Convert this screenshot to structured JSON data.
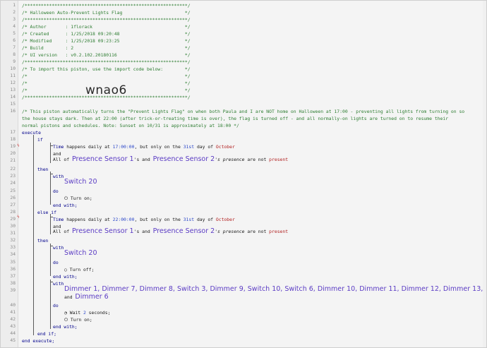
{
  "watermark": "wnao6",
  "header_lines": [
    "/************************************************************/",
    "/* Halloween Auto-Prevent Lights Flag                       */",
    "/************************************************************/",
    "/* Author       : 1florack                                  */",
    "/* Created      : 1/25/2018 09:20:48                        */",
    "/* Modified     : 1/25/2018 09:23:25                        */",
    "/* Build        : 2                                         */",
    "/* UI version   : v0.2.102.20180116                         */",
    "/************************************************************/",
    "/* To import this piston, use the import code below:        */",
    "/*                                                          */",
    "/*                                                          */",
    "/*                                                          */",
    "/************************************************************/"
  ],
  "comment_lines": [
    "/* This piston automatically turns the \"Prevent Lights Flag\" on when both Paula and I are NOT home on Halloween at 17:00 - preventing all lights from turning on so",
    "the house stays dark. Then at 22:00 (after trick-or-treating time is over), the flag is turned off - and all normally-on lights are turned on to resume their",
    "normal pistons and schedules. Note: Sunset on 10/31 is approximately at 18:00 */"
  ],
  "kw": {
    "execute": "execute",
    "if": "if",
    "and": "and",
    "then": "then",
    "with": "with",
    "do": "do",
    "end_with": "end with;",
    "else_if": "else if",
    "end_if": "end if;",
    "end_execute": "end execute;",
    "time": "Time",
    "all_of": "All of",
    "and2": "and",
    "s": "'s",
    "happens": " happens daily at ",
    "but_only": ", but only on the ",
    "day_of": " day of ",
    "presence": "'s presence",
    "are_not": " are not ",
    "turn_on": "Turn on;",
    "turn_off": "Turn off;",
    "wait": "Wait ",
    "seconds": " seconds;"
  },
  "cond1": {
    "time": "17:00:00",
    "day": "31st",
    "month": "October"
  },
  "cond2": {
    "time": "22:00:00",
    "day": "31st",
    "month": "October"
  },
  "sensors": {
    "a": "Presence Sensor 1",
    "b": "Presence Sensor 2",
    "state": "present"
  },
  "switch": "Switch 20",
  "wait_seconds": "2",
  "devices_line1": "Dimmer 1, Dimmer 7, Dimmer 8, Switch 3, Dimmer 9, Switch 10, Switch 6, Dimmer 10, Dimmer 11, Dimmer 12, Dimmer 13,",
  "devices_line2_prefix": "and ",
  "devices_line2": "Dimmer 6",
  "line_numbers": [
    "1",
    "2",
    "3",
    "4",
    "5",
    "6",
    "7",
    "8",
    "9",
    "10",
    "11",
    "12",
    "13",
    "14",
    "15",
    "16",
    "17",
    "18",
    "19",
    "20",
    "21",
    "22",
    "23",
    "24",
    "25",
    "26",
    "27",
    "28",
    "29",
    "30",
    "31",
    "32",
    "33",
    "34",
    "35",
    "36",
    "37",
    "38",
    "39",
    "40",
    "41",
    "42",
    "43",
    "44",
    "45"
  ]
}
